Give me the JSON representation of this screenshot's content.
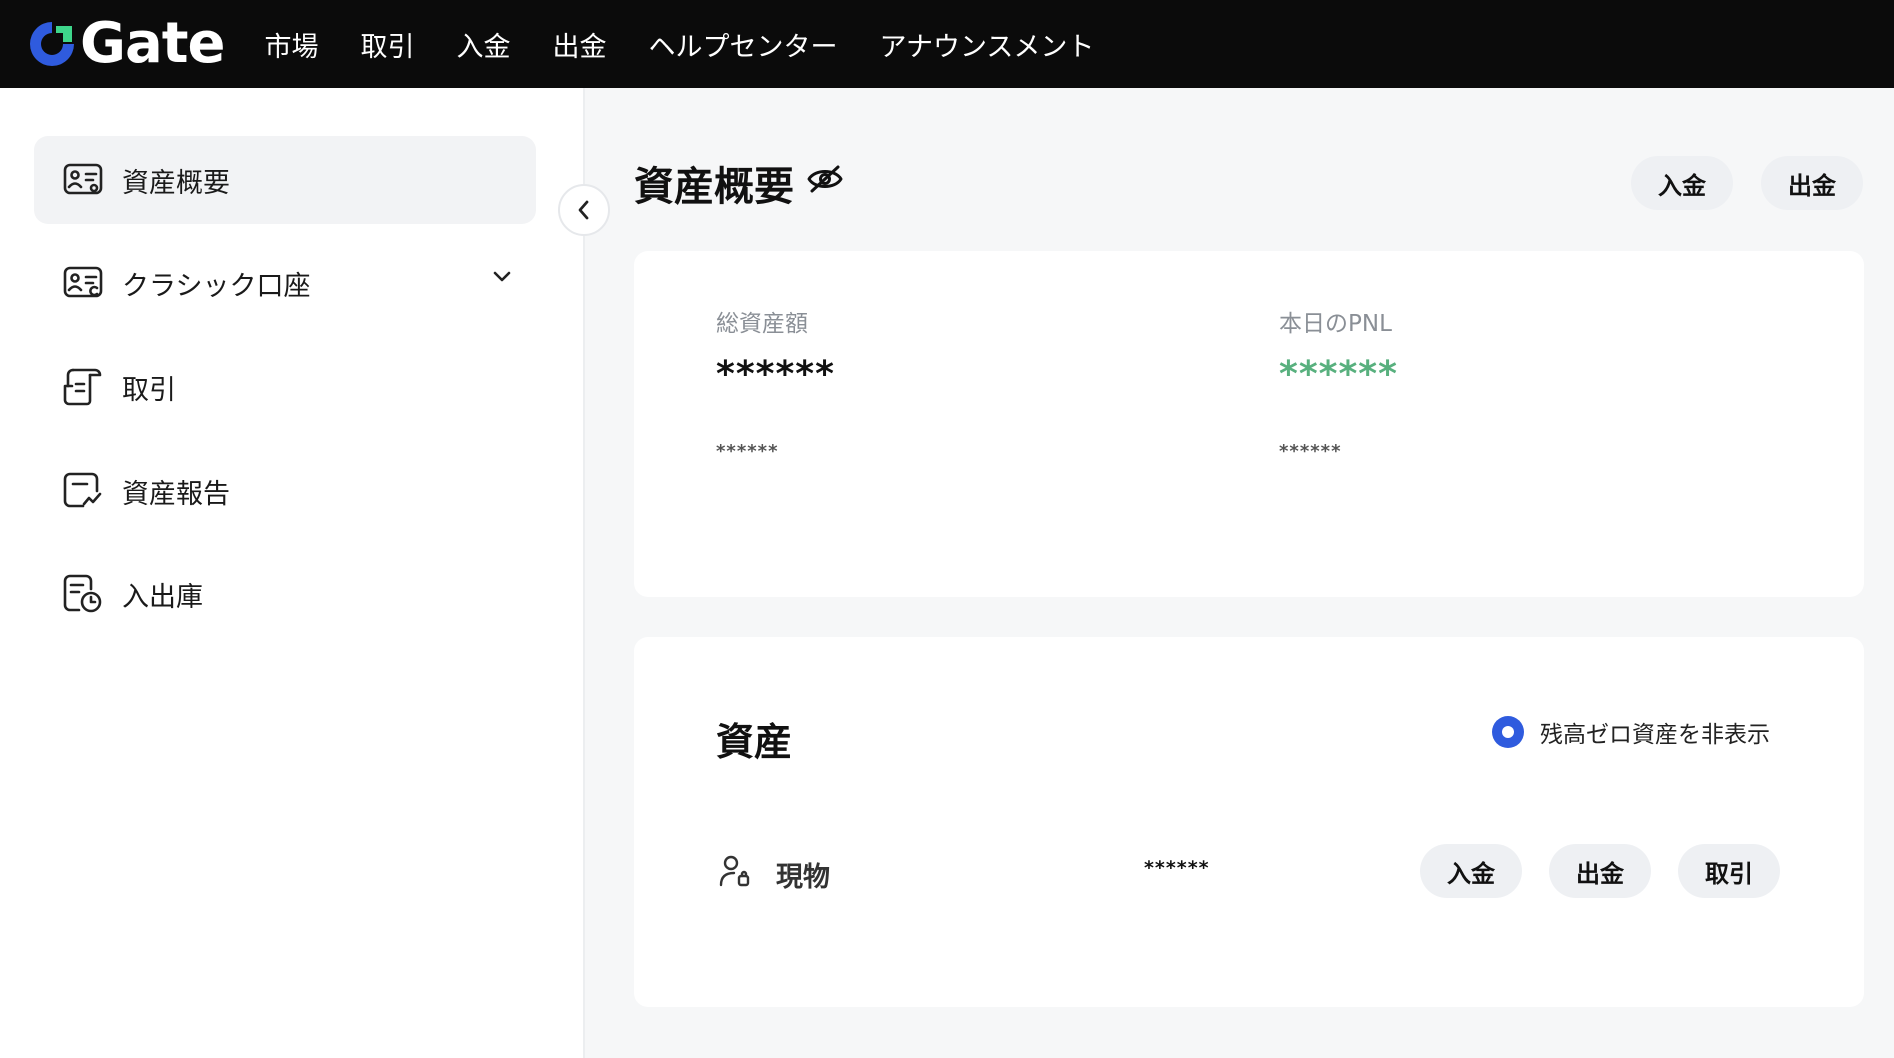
{
  "brand": {
    "name": "Gate",
    "accent": "#2f5bde",
    "accent_green": "#3ed68b"
  },
  "nav": {
    "items": [
      "市場",
      "取引",
      "入金",
      "出金",
      "ヘルプセンター",
      "アナウンスメント"
    ]
  },
  "sidebar": {
    "items": [
      {
        "label": "資産概要",
        "icon": "wallet-card-icon",
        "active": true
      },
      {
        "label": "クラシック口座",
        "icon": "account-card-icon",
        "expandable": true
      },
      {
        "label": "取引",
        "icon": "transaction-icon"
      },
      {
        "label": "資産報告",
        "icon": "report-icon"
      },
      {
        "label": "入出庫",
        "icon": "history-icon"
      }
    ]
  },
  "header": {
    "title": "資産概要",
    "deposit_label": "入金",
    "withdraw_label": "出金"
  },
  "overview": {
    "total_label": "総資産額",
    "total_value": "******",
    "total_sub": "******",
    "pnl_label": "本日のPNL",
    "pnl_value": "******",
    "pnl_sub": "******",
    "pnl_color": "#58b07e"
  },
  "assets": {
    "title": "資産",
    "hide_zero_label": "残高ゼロ資産を非表示",
    "hide_zero_checked": true,
    "rows": [
      {
        "name": "現物",
        "value": "******",
        "deposit_label": "入金",
        "withdraw_label": "出金",
        "trade_label": "取引"
      }
    ]
  }
}
